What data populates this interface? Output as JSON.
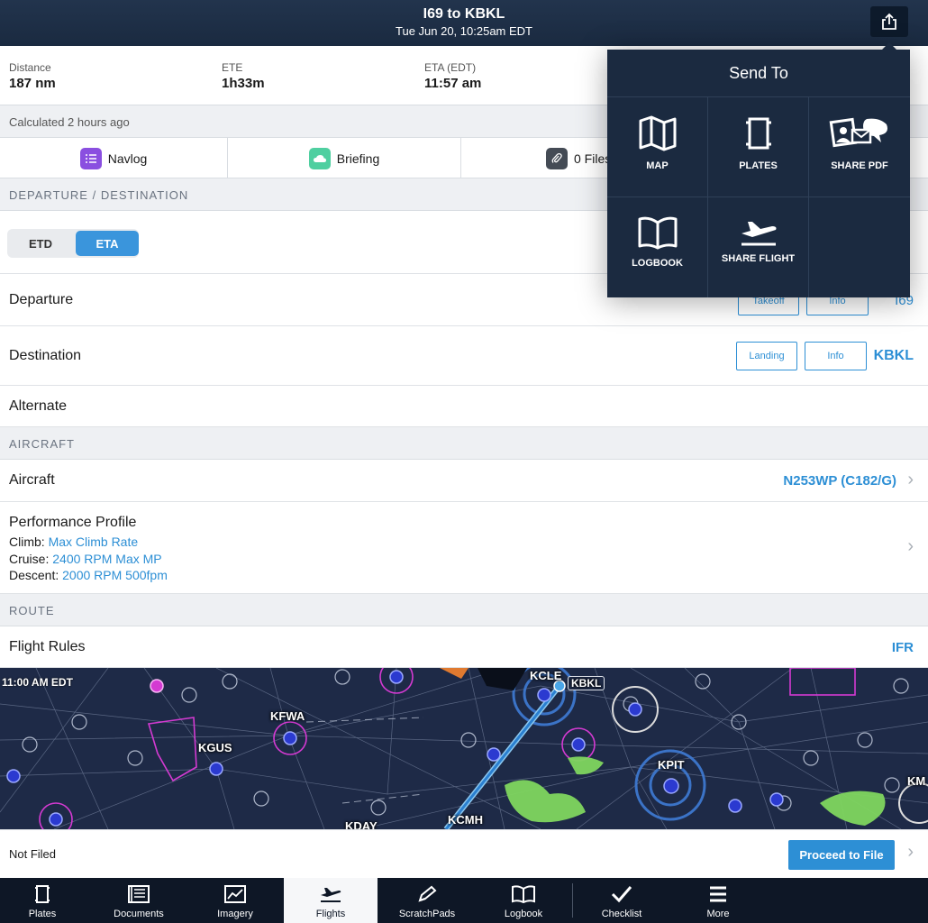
{
  "header": {
    "title": "I69 to KBKL",
    "subtitle": "Tue Jun 20, 10:25am EDT",
    "share_icon": "share-icon"
  },
  "stats": [
    {
      "label": "Distance",
      "value": "187 nm"
    },
    {
      "label": "ETE",
      "value": "1h33m"
    },
    {
      "label": "ETA (EDT)",
      "value": "11:57 am"
    }
  ],
  "calculated": "Calculated 2 hours ago",
  "tabs": [
    {
      "label": "Navlog",
      "icon": "list-icon",
      "color": "#8a4fe0"
    },
    {
      "label": "Briefing",
      "icon": "cloud-icon",
      "color": "#4fcfa0"
    },
    {
      "label": "0 Files",
      "icon": "paperclip-icon",
      "color": "#444b55"
    }
  ],
  "sections": {
    "departure_destination": "DEPARTURE / DESTINATION",
    "aircraft": "AIRCRAFT",
    "route": "ROUTE"
  },
  "time_mode": {
    "etd": "ETD",
    "eta": "ETA",
    "selected": "ETA"
  },
  "departure": {
    "label": "Departure",
    "btn1": "Takeoff",
    "btn2": "Info",
    "value": "I69"
  },
  "destination": {
    "label": "Destination",
    "btn1": "Landing",
    "btn2": "Info",
    "value": "KBKL"
  },
  "alternate": {
    "label": "Alternate"
  },
  "aircraft": {
    "label": "Aircraft",
    "value": "N253WP (C182/G)"
  },
  "performance": {
    "label": "Performance Profile",
    "climb_label": "Climb:",
    "climb_value": "Max Climb Rate",
    "cruise_label": "Cruise:",
    "cruise_value": "2400 RPM Max MP",
    "descent_label": "Descent:",
    "descent_value": "2000 RPM 500fpm"
  },
  "flight_rules": {
    "label": "Flight Rules",
    "value": "IFR"
  },
  "map": {
    "time": "11:00 AM EDT",
    "airports": [
      "KCLE",
      "KBKL",
      "KFWA",
      "KGUS",
      "KPIT",
      "KDAY",
      "KCMH",
      "KM"
    ]
  },
  "filing": {
    "status": "Not Filed",
    "button": "Proceed to File"
  },
  "tabbar": [
    {
      "label": "Plates",
      "icon": "plates-icon"
    },
    {
      "label": "Documents",
      "icon": "documents-icon"
    },
    {
      "label": "Imagery",
      "icon": "imagery-icon"
    },
    {
      "label": "Flights",
      "icon": "airplane-icon",
      "active": true
    },
    {
      "label": "ScratchPads",
      "icon": "pencil-icon"
    },
    {
      "label": "Logbook",
      "icon": "book-icon"
    },
    {
      "label": "Checklist",
      "icon": "checkmark-icon"
    },
    {
      "label": "More",
      "icon": "menu-icon"
    }
  ],
  "send_to": {
    "title": "Send To",
    "items": [
      {
        "label": "MAP",
        "icon": "map-icon"
      },
      {
        "label": "PLATES",
        "icon": "plates-icon"
      },
      {
        "label": "SHARE PDF",
        "icon": "share-pdf-icon"
      },
      {
        "label": "LOGBOOK",
        "icon": "logbook-icon"
      },
      {
        "label": "SHARE FLIGHT",
        "icon": "airplane-icon"
      }
    ]
  }
}
